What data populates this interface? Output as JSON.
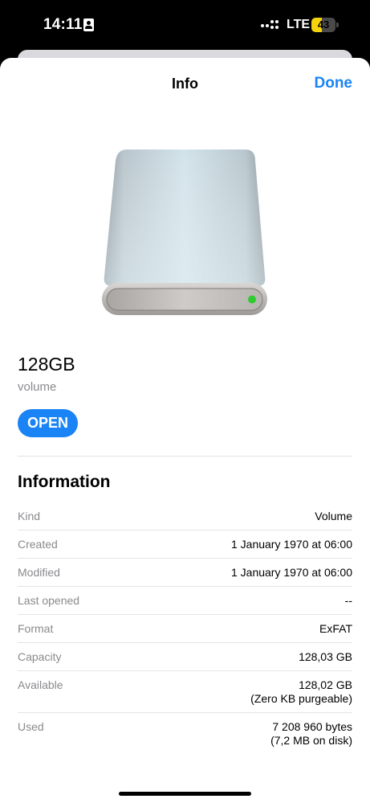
{
  "status_bar": {
    "time": "14:11",
    "network": "LTE",
    "battery": "43",
    "battery_level": 0.43
  },
  "nav": {
    "title": "Info",
    "done_label": "Done"
  },
  "volume": {
    "name": "128GB",
    "kind": "volume",
    "open_label": "OPEN"
  },
  "information": {
    "title": "Information",
    "rows": [
      {
        "label": "Kind",
        "value": "Volume"
      },
      {
        "label": "Created",
        "value": "1 January 1970 at 06:00"
      },
      {
        "label": "Modified",
        "value": "1 January 1970 at 06:00"
      },
      {
        "label": "Last opened",
        "value": "--"
      },
      {
        "label": "Format",
        "value": "ExFAT"
      },
      {
        "label": "Capacity",
        "value": "128,03 GB"
      },
      {
        "label": "Available",
        "value": "128,02 GB",
        "value2": "(Zero KB purgeable)"
      },
      {
        "label": "Used",
        "value": "7 208 960 bytes",
        "value2": "(7,2 MB on disk)"
      }
    ]
  },
  "colors": {
    "accent": "#1a83f5",
    "drive_led": "#2ecc2e"
  },
  "icons": {
    "drive": "external-drive-icon"
  }
}
